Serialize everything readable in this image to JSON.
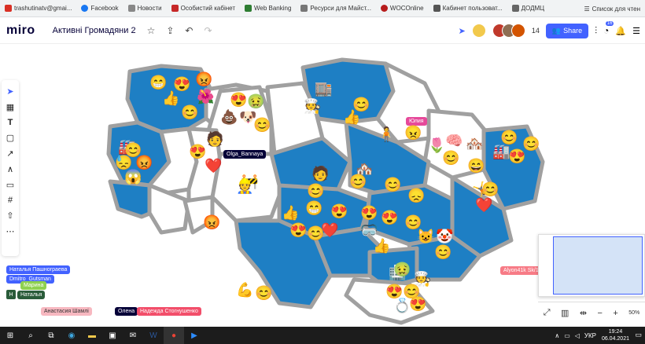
{
  "bookmarks": [
    {
      "label": "trashutinatv@gmai...",
      "color": "#d93025"
    },
    {
      "label": "Facebook",
      "color": "#1877f2"
    },
    {
      "label": "Новости",
      "color": "#888888"
    },
    {
      "label": "Особистий кабінет",
      "color": "#c62828"
    },
    {
      "label": "Web Banking",
      "color": "#2e7d32"
    },
    {
      "label": "Ресурси для Майст...",
      "color": "#777777"
    },
    {
      "label": "WOCOnline",
      "color": "#b71c1c"
    },
    {
      "label": "Кабинет пользоват...",
      "color": "#555555"
    },
    {
      "label": "ДОДМЦ",
      "color": "#666666"
    }
  ],
  "bookmarks_right": "Список для чтен",
  "app": {
    "logo": "miro",
    "board_title": "Активні Громадяни 2"
  },
  "toolbar": {
    "share_label": "Share",
    "participant_count": "14",
    "notification_count": "16"
  },
  "left_tools": [
    "select",
    "template",
    "text",
    "shape",
    "pen",
    "highlighter",
    "comment",
    "frame",
    "upload",
    "more"
  ],
  "name_tags": [
    {
      "label": "Юлия",
      "color": "#e6499a"
    },
    {
      "label": "Olga_Bannaya",
      "color": "#050038"
    },
    {
      "label": "Alyon41k Sk/1",
      "color": "#f77b86"
    },
    {
      "label": "Наталья Пашнограева",
      "color": "#4262ff"
    },
    {
      "label": "Dmitro_Gutsman",
      "color": "#4262ff"
    },
    {
      "label": "Марина",
      "color": "#8fd14f"
    },
    {
      "label": "Наталья",
      "color": "#2a5c3a"
    },
    {
      "label": "Анастасия Шамлі",
      "color": "#f7b8c0"
    },
    {
      "label": "Олена",
      "color": "#050038"
    },
    {
      "label": "Надежда Стогнушенко",
      "color": "#f24e6a"
    }
  ],
  "avatar_initial": "H",
  "minimap": {
    "zoom": "50%"
  },
  "taskbar": {
    "lang": "УКР",
    "time": "19:24",
    "date": "06.04.2021"
  },
  "map_colors": {
    "region": "#1e7fc4",
    "border": "#a0a0a0",
    "background": "#ffffff"
  }
}
